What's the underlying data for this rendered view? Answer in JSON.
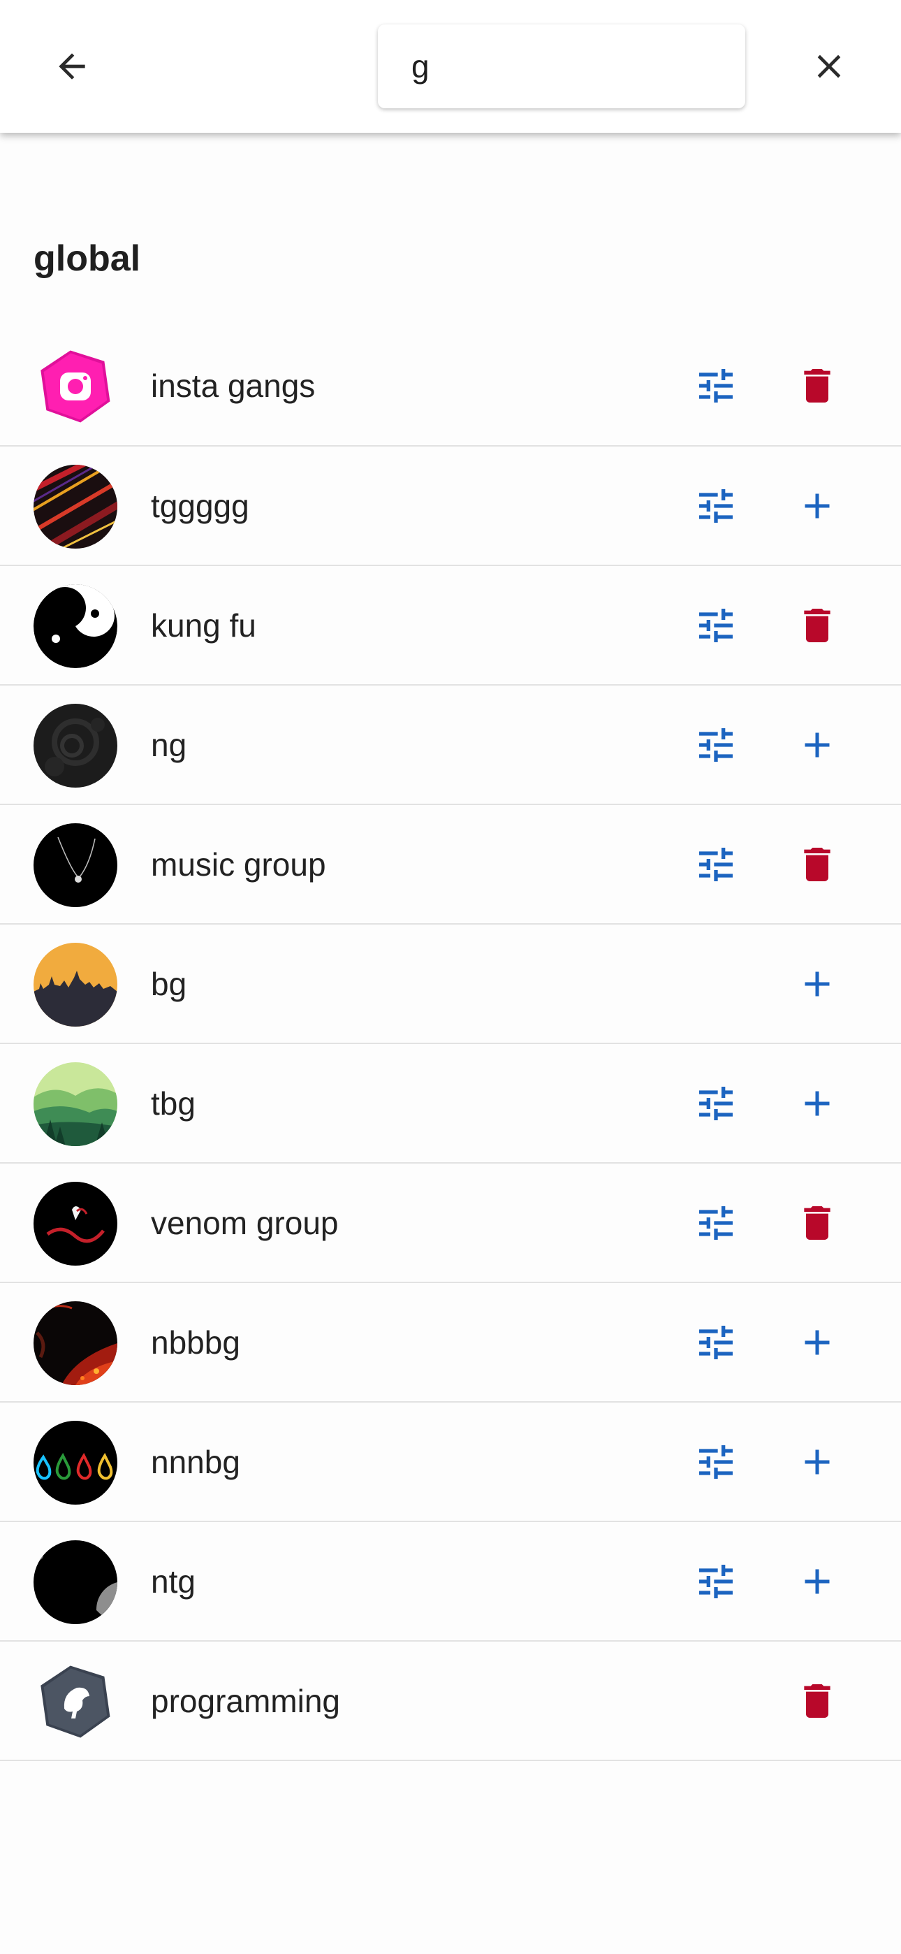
{
  "search": {
    "value": "g"
  },
  "icons": {
    "back": "arrow-back-icon",
    "close": "close-icon",
    "settings": "tune-icon",
    "delete": "trash-icon",
    "add": "plus-icon"
  },
  "colors": {
    "accent": "#1c64c0",
    "delete": "#b8082a"
  },
  "section": {
    "title": "global"
  },
  "items": [
    {
      "label": "insta gangs",
      "avatar": "insta-logo",
      "settings": true,
      "action": "delete"
    },
    {
      "label": "tggggg",
      "avatar": "red-streaks",
      "settings": true,
      "action": "add"
    },
    {
      "label": "kung fu",
      "avatar": "yin-yang",
      "settings": true,
      "action": "delete"
    },
    {
      "label": "ng",
      "avatar": "dark-texture",
      "settings": true,
      "action": "add"
    },
    {
      "label": "music group",
      "avatar": "black-pendant",
      "settings": true,
      "action": "delete"
    },
    {
      "label": "bg",
      "avatar": "sunset-city",
      "settings": false,
      "action": "add"
    },
    {
      "label": "tbg",
      "avatar": "green-forest",
      "settings": true,
      "action": "add"
    },
    {
      "label": "venom group",
      "avatar": "venom",
      "settings": true,
      "action": "delete"
    },
    {
      "label": "nbbbg",
      "avatar": "lava",
      "settings": true,
      "action": "add"
    },
    {
      "label": "nnnbg",
      "avatar": "color-drops",
      "settings": true,
      "action": "add"
    },
    {
      "label": "ntg",
      "avatar": "black-moon",
      "settings": true,
      "action": "add"
    },
    {
      "label": "programming",
      "avatar": "programming-logo",
      "settings": false,
      "action": "delete"
    }
  ]
}
